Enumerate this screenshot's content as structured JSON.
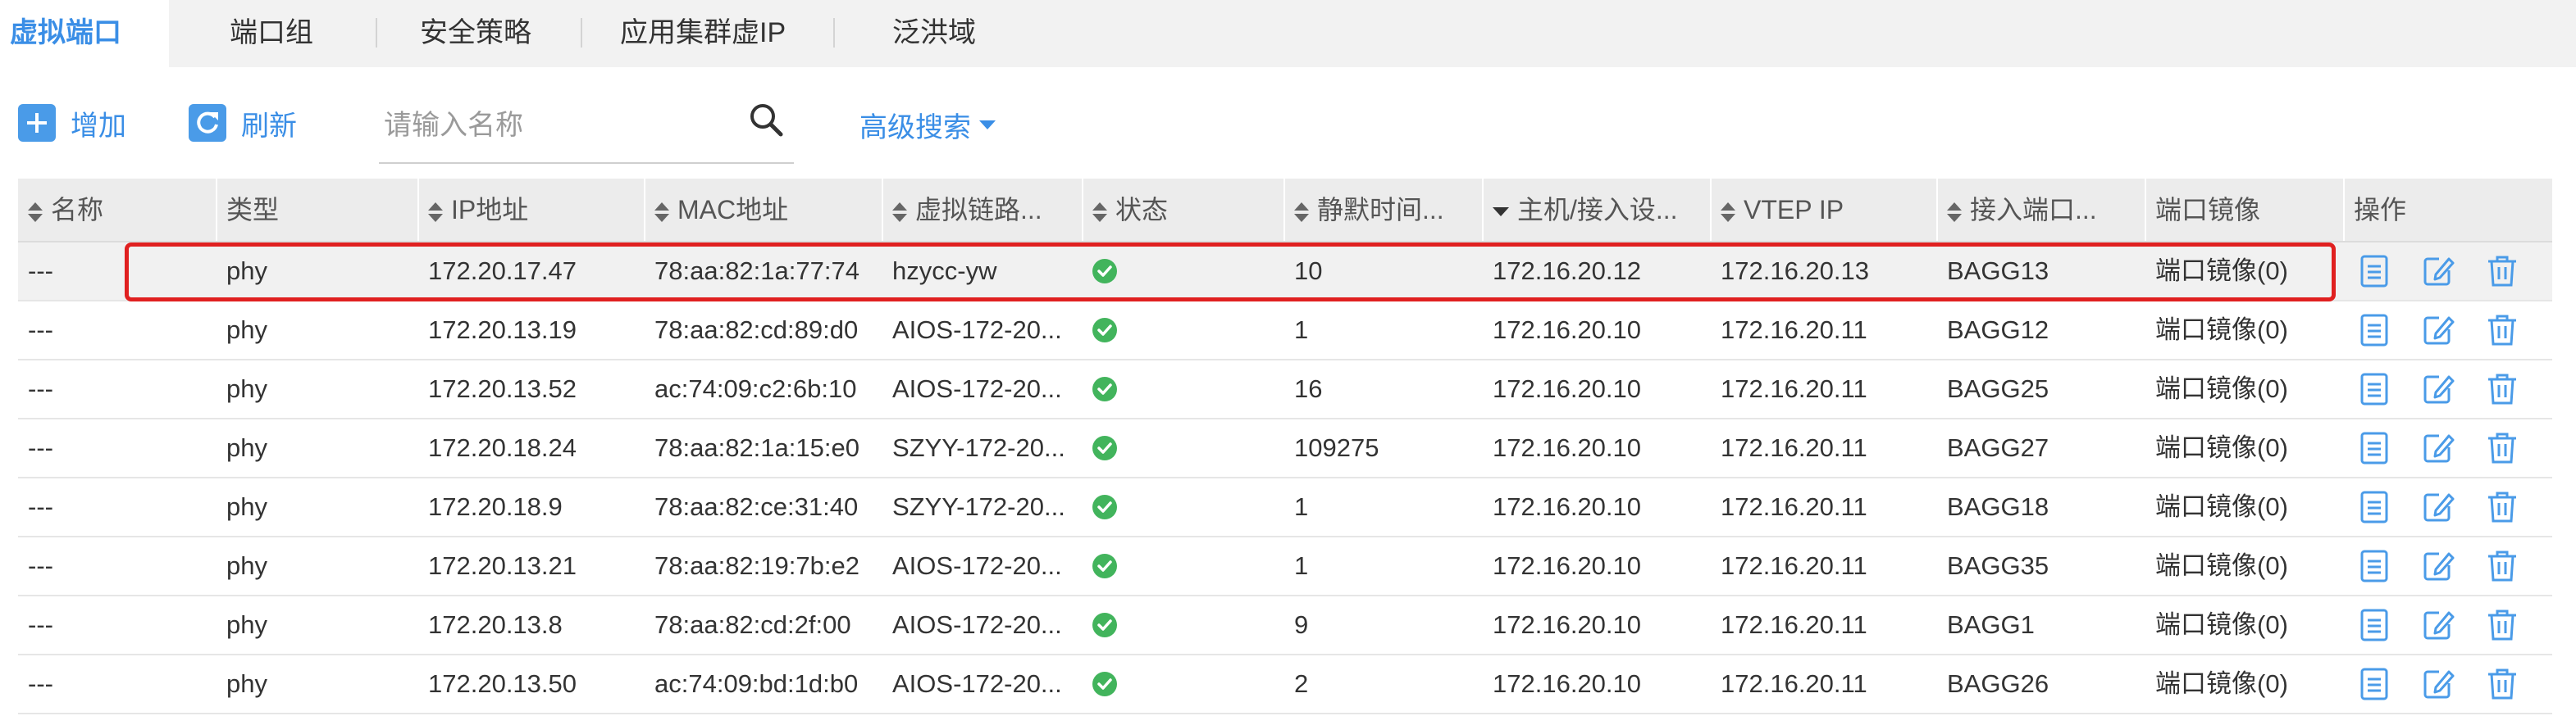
{
  "tabs": [
    {
      "label": "虚拟端口",
      "active": true
    },
    {
      "label": "端口组",
      "active": false
    },
    {
      "label": "安全策略",
      "active": false
    },
    {
      "label": "应用集群虚IP",
      "active": false
    },
    {
      "label": "泛洪域",
      "active": false
    }
  ],
  "toolbar": {
    "add_label": "增加",
    "refresh_label": "刷新",
    "search_placeholder": "请输入名称",
    "search_value": "",
    "advanced_search_label": "高级搜索"
  },
  "icons": {
    "add": "plus-icon",
    "refresh": "refresh-icon",
    "search": "search-icon",
    "status_ok": "check-circle-icon",
    "detail": "document-icon",
    "edit": "edit-icon",
    "delete": "trash-icon"
  },
  "colors": {
    "accent": "#3a8ee6",
    "status_ok": "#42b45c",
    "highlight": "#e02020"
  },
  "table": {
    "columns": [
      {
        "label": "名称",
        "sort": "both"
      },
      {
        "label": "类型",
        "sort": "none"
      },
      {
        "label": "IP地址",
        "sort": "both"
      },
      {
        "label": "MAC地址",
        "sort": "both"
      },
      {
        "label": "虚拟链路...",
        "sort": "both"
      },
      {
        "label": "状态",
        "sort": "both"
      },
      {
        "label": "静默时间...",
        "sort": "both"
      },
      {
        "label": "主机/接入设...",
        "sort": "desc"
      },
      {
        "label": "VTEP IP",
        "sort": "both"
      },
      {
        "label": "接入端口...",
        "sort": "both"
      },
      {
        "label": "端口镜像",
        "sort": "none"
      },
      {
        "label": "操作",
        "sort": "none"
      }
    ],
    "rows": [
      {
        "name": "---",
        "type": "phy",
        "ip": "172.20.17.47",
        "mac": "78:aa:82:1a:77:74",
        "vlink": "hzycc-yw",
        "status": "ok",
        "silent": "10",
        "host": "172.16.20.12",
        "vtep": "172.16.20.13",
        "port": "BAGG13",
        "mirror": "端口镜像(0)"
      },
      {
        "name": "---",
        "type": "phy",
        "ip": "172.20.13.19",
        "mac": "78:aa:82:cd:89:d0",
        "vlink": "AIOS-172-20...",
        "status": "ok",
        "silent": "1",
        "host": "172.16.20.10",
        "vtep": "172.16.20.11",
        "port": "BAGG12",
        "mirror": "端口镜像(0)"
      },
      {
        "name": "---",
        "type": "phy",
        "ip": "172.20.13.52",
        "mac": "ac:74:09:c2:6b:10",
        "vlink": "AIOS-172-20...",
        "status": "ok",
        "silent": "16",
        "host": "172.16.20.10",
        "vtep": "172.16.20.11",
        "port": "BAGG25",
        "mirror": "端口镜像(0)"
      },
      {
        "name": "---",
        "type": "phy",
        "ip": "172.20.18.24",
        "mac": "78:aa:82:1a:15:e0",
        "vlink": "SZYY-172-20...",
        "status": "ok",
        "silent": "109275",
        "host": "172.16.20.10",
        "vtep": "172.16.20.11",
        "port": "BAGG27",
        "mirror": "端口镜像(0)"
      },
      {
        "name": "---",
        "type": "phy",
        "ip": "172.20.18.9",
        "mac": "78:aa:82:ce:31:40",
        "vlink": "SZYY-172-20...",
        "status": "ok",
        "silent": "1",
        "host": "172.16.20.10",
        "vtep": "172.16.20.11",
        "port": "BAGG18",
        "mirror": "端口镜像(0)"
      },
      {
        "name": "---",
        "type": "phy",
        "ip": "172.20.13.21",
        "mac": "78:aa:82:19:7b:e2",
        "vlink": "AIOS-172-20...",
        "status": "ok",
        "silent": "1",
        "host": "172.16.20.10",
        "vtep": "172.16.20.11",
        "port": "BAGG35",
        "mirror": "端口镜像(0)"
      },
      {
        "name": "---",
        "type": "phy",
        "ip": "172.20.13.8",
        "mac": "78:aa:82:cd:2f:00",
        "vlink": "AIOS-172-20...",
        "status": "ok",
        "silent": "9",
        "host": "172.16.20.10",
        "vtep": "172.16.20.11",
        "port": "BAGG1",
        "mirror": "端口镜像(0)"
      },
      {
        "name": "---",
        "type": "phy",
        "ip": "172.20.13.50",
        "mac": "ac:74:09:bd:1d:b0",
        "vlink": "AIOS-172-20...",
        "status": "ok",
        "silent": "2",
        "host": "172.16.20.10",
        "vtep": "172.16.20.11",
        "port": "BAGG26",
        "mirror": "端口镜像(0)"
      }
    ]
  }
}
